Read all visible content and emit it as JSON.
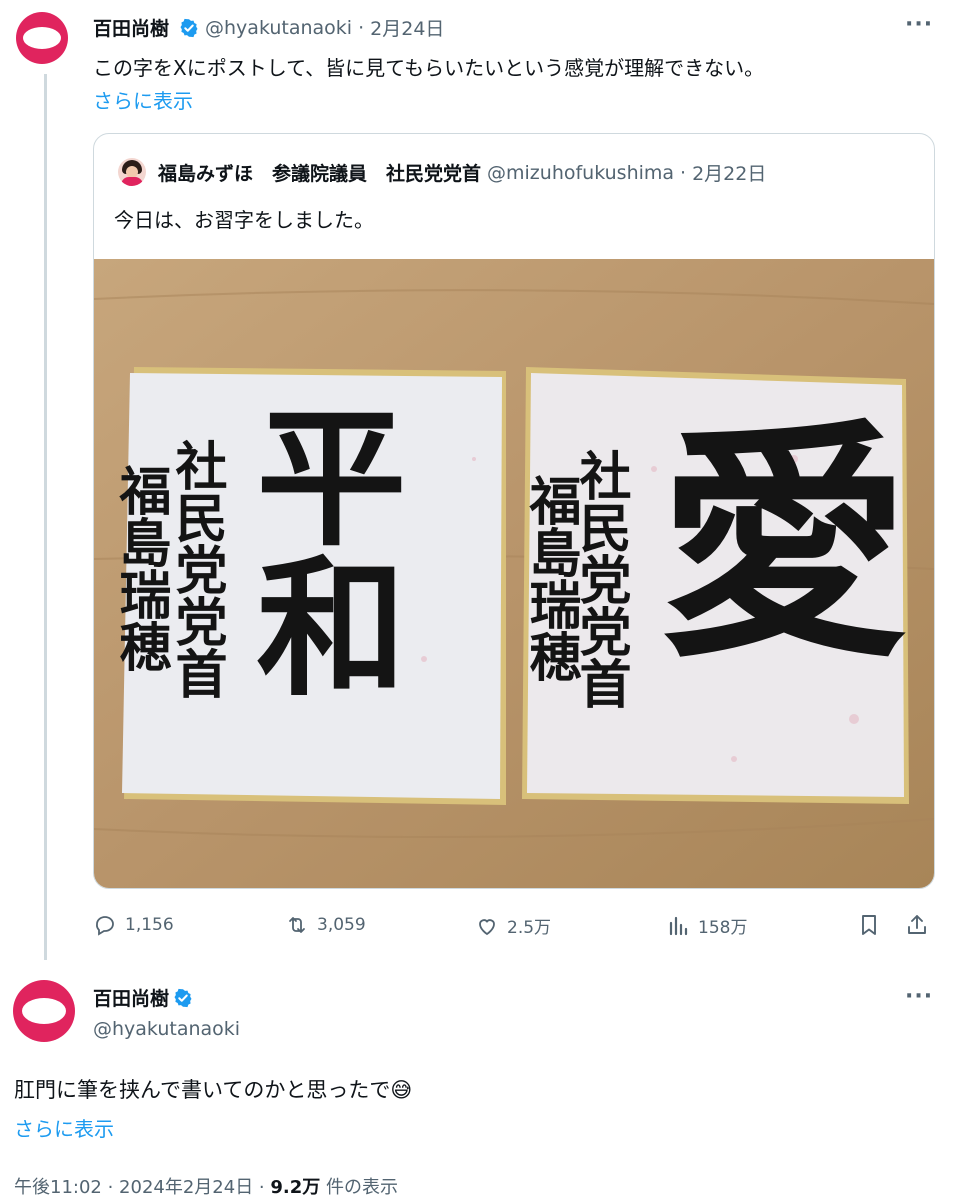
{
  "tweet1": {
    "name": "百田尚樹",
    "handle": "@hyakutanaoki",
    "sep": "·",
    "date": "2月24日",
    "text": "この字をXにポストして、皆に見てもらいたいという感覚が理解できない。",
    "show_more": "さらに表示",
    "more_icon": "···"
  },
  "quote": {
    "name": "福島みずほ　参議院議員　社民党党首",
    "handle": "@mizuhofukushima",
    "sep": "·",
    "date": "2月22日",
    "text": "今日は、お習字をしました。",
    "board_left": {
      "big": "平和",
      "small_right": "社民党党首",
      "small_left": "福島瑞穂"
    },
    "board_right": {
      "big": "愛",
      "small_right": "社民党党首",
      "small_left": "福島瑞穂"
    }
  },
  "actions": {
    "replies": "1,156",
    "reposts": "3,059",
    "likes": "2.5万",
    "views": "158万"
  },
  "tweet2": {
    "name": "百田尚樹",
    "handle": "@hyakutanaoki",
    "text": "肛門に筆を挟んで書いてのかと思ったで",
    "emoji": "😅",
    "show_more": "さらに表示",
    "more_icon": "···",
    "timestamp": "午後11:02 · 2024年2月24日 · ",
    "view_count": "9.2万",
    "view_suffix": " 件の表示"
  },
  "colors": {
    "accent": "#1d9bf0",
    "avatar": "#e0245e",
    "muted": "#536471",
    "border": "#cfd9de"
  }
}
